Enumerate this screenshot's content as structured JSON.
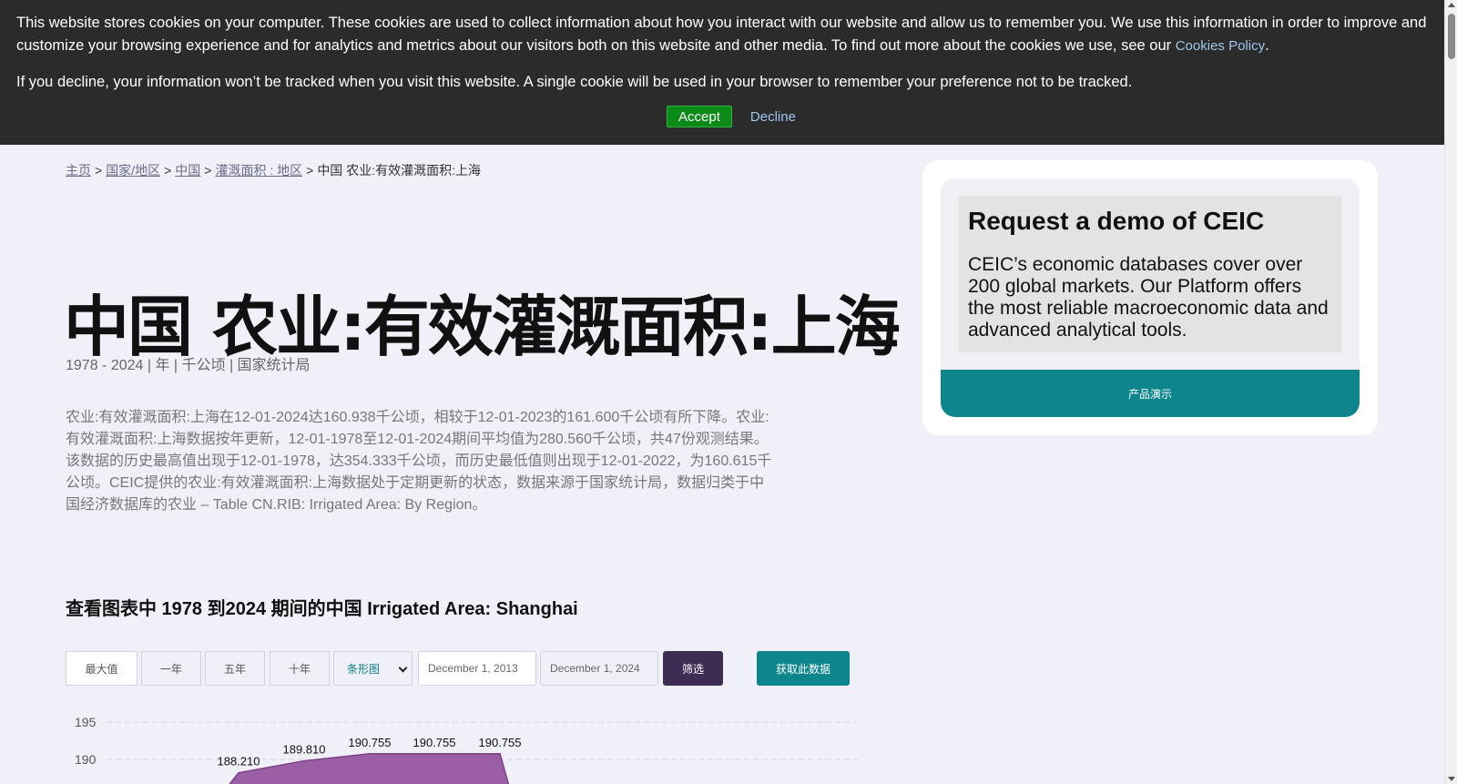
{
  "cookie_banner": {
    "text1": "This website stores cookies on your computer. These cookies are used to collect information about how you interact with our website and allow us to remember you. We use this information in order to improve and customize your browsing experience and for analytics and metrics about our visitors both on this website and other media. To find out more about the cookies we use, see our ",
    "policy_link": "Cookies Policy",
    "text1_end": ".",
    "text2": "If you decline, your information won’t be tracked when you visit this website. A single cookie will be used in your browser to remember your preference not to be tracked.",
    "accept_label": "Accept",
    "decline_label": "Decline"
  },
  "breadcrumb": {
    "items": [
      "主页",
      "国家/地区",
      "中国",
      "灌溉面积 : 地区"
    ],
    "separator": ">",
    "current": "中国 农业:有效灌溉面积:上海"
  },
  "page": {
    "title": "中国 农业:有效灌溉面积:上海",
    "meta": "1978 - 2024 | 年 | 千公顷 | 国家统计局",
    "description": "农业:有效灌溉面积:上海在12-01-2024达160.938千公顷，相较于12-01-2023的161.600千公顷有所下降。农业:有效灌溉面积:上海数据按年更新，12-01-1978至12-01-2024期间平均值为280.560千公顷，共47份观测结果。该数据的历史最高值出现于12-01-1978，达354.333千公顷，而历史最低值则出现于12-01-2022，为160.615千公顷。CEIC提供的农业:有效灌溉面积:上海数据处于定期更新的状态，数据来源于国家统计局，数据归类于中国经济数据库的农业 – Table CN.RIB: Irrigated Area: By Region。",
    "chart_heading": "查看图表中 1978 到2024 期间的中国 Irrigated Area: Shanghai"
  },
  "filters": {
    "max": "最大值",
    "one_year": "一年",
    "five_year": "五年",
    "ten_year": "十年",
    "chart_type": "条形图",
    "start_date": "December 1, 2013",
    "end_date": "December 1, 2024",
    "filter_label": "筛选",
    "get_data_label": "获取此数据"
  },
  "demo": {
    "title": "Request a demo of CEIC",
    "text": "CEIC’s economic databases cover over 200 global markets. Our Platform offers the most reliable macroeconomic data and advanced analytical tools.",
    "button": "产品演示"
  },
  "colors": {
    "banner_bg": "#2b2b2b",
    "accent_teal": "#0c868c",
    "filter_purple": "#3f2c53",
    "area_fill": "#9c5fa6"
  },
  "chart_data": {
    "type": "area",
    "y_ticks": [
      195,
      190
    ],
    "points": [
      {
        "label": "188.210",
        "value": 188.21
      },
      {
        "label": "189.810",
        "value": 189.81
      },
      {
        "label": "190.755",
        "value": 190.755
      },
      {
        "label": "190.755",
        "value": 190.755
      },
      {
        "label": "190.755",
        "value": 190.755
      }
    ],
    "grid": true
  }
}
